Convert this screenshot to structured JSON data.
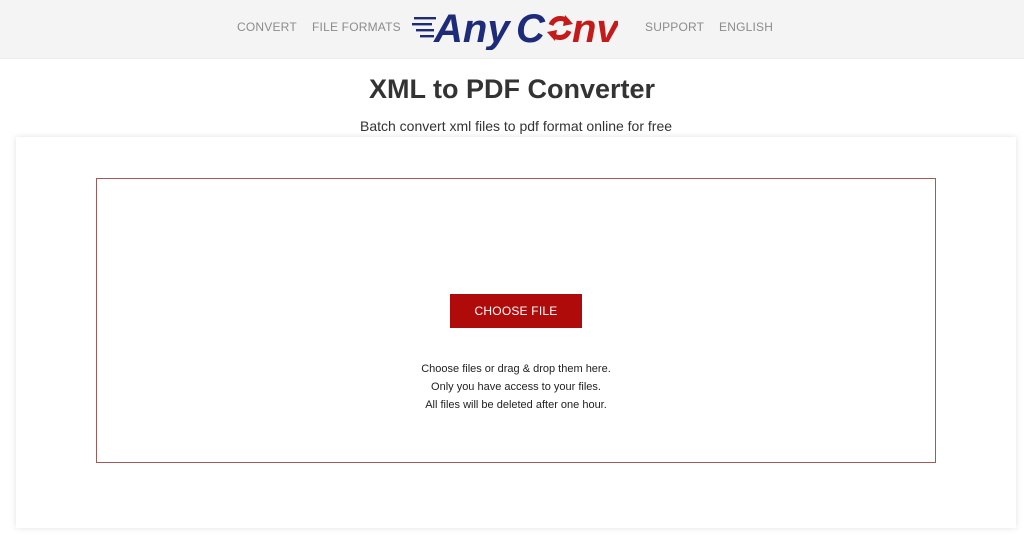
{
  "header": {
    "nav_left": [
      "CONVERT",
      "FILE FORMATS"
    ],
    "nav_right": [
      "SUPPORT",
      "ENGLISH"
    ],
    "logo_text": {
      "part1": "Any",
      "part2": "C",
      "part3": "nv"
    },
    "colors": {
      "navy": "#1d2b79",
      "red": "#c41a1a"
    }
  },
  "main": {
    "title": "XML to PDF Converter",
    "subtitle": "Batch convert xml files to pdf format online for free"
  },
  "uploader": {
    "button_label": "CHOOSE FILE",
    "hints": [
      "Choose files or drag & drop them here.",
      "Only you have access to your files.",
      "All files will be deleted after one hour."
    ],
    "colors": {
      "button": "#b00b0b",
      "border": "#a05a5a"
    }
  }
}
